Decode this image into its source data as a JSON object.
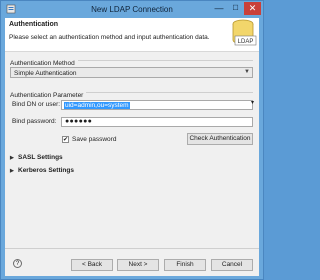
{
  "window": {
    "title": "New LDAP Connection",
    "controls": {
      "minimize": "—",
      "maximize": "☐",
      "close": "✕"
    }
  },
  "header": {
    "title": "Authentication",
    "description": "Please select an authentication method and input authentication data.",
    "logo_text": "LDAP"
  },
  "method_group": {
    "label": "Authentication Method",
    "selected": "Simple Authentication"
  },
  "param_group": {
    "label": "Authentication Parameter",
    "bind_dn_label": "Bind DN or user:",
    "bind_dn_value": "uid=admin,ou=system",
    "bind_password_label": "Bind password:",
    "bind_password_value": "●●●●●●",
    "save_password_label": "Save password",
    "save_password_checked": true,
    "check_button": "Check Authentication"
  },
  "sections": [
    "SASL Settings",
    "Kerberos Settings"
  ],
  "footer": {
    "back": "< Back",
    "next": "Next >",
    "finish": "Finish",
    "cancel": "Cancel"
  }
}
